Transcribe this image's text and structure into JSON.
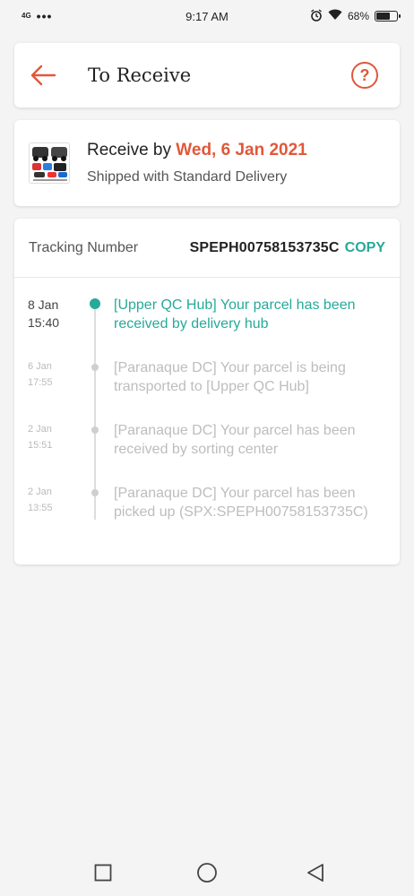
{
  "status_bar": {
    "network": "4G",
    "time": "9:17 AM",
    "battery": "68%",
    "battery_level": 0.68
  },
  "header": {
    "title": "To Receive",
    "back_icon": "arrow-left-icon",
    "help_icon": "question-circle-icon",
    "help_label": "?"
  },
  "receive": {
    "prefix": "Receive by ",
    "date": "Wed, 6 Jan 2021",
    "shipping": "Shipped with Standard Delivery"
  },
  "tracking": {
    "label": "Tracking Number",
    "number": "SPEPH00758153735C",
    "copy_label": "COPY"
  },
  "events": [
    {
      "date": "8 Jan",
      "time": "15:40",
      "text": "[Upper QC Hub] Your parcel has been received by delivery hub",
      "active": true
    },
    {
      "date": "6 Jan",
      "time": "17:55",
      "text": "[Paranaque DC] Your parcel is being transported to [Upper QC Hub]",
      "active": false
    },
    {
      "date": "2 Jan",
      "time": "15:51",
      "text": "[Paranaque DC] Your parcel has been received by sorting center",
      "active": false
    },
    {
      "date": "2 Jan",
      "time": "13:55",
      "text": "[Paranaque DC] Your parcel has been picked up (SPX:SPEPH00758153735C)",
      "active": false
    }
  ],
  "colors": {
    "accent": "#e1573a",
    "teal": "#26aa99"
  }
}
